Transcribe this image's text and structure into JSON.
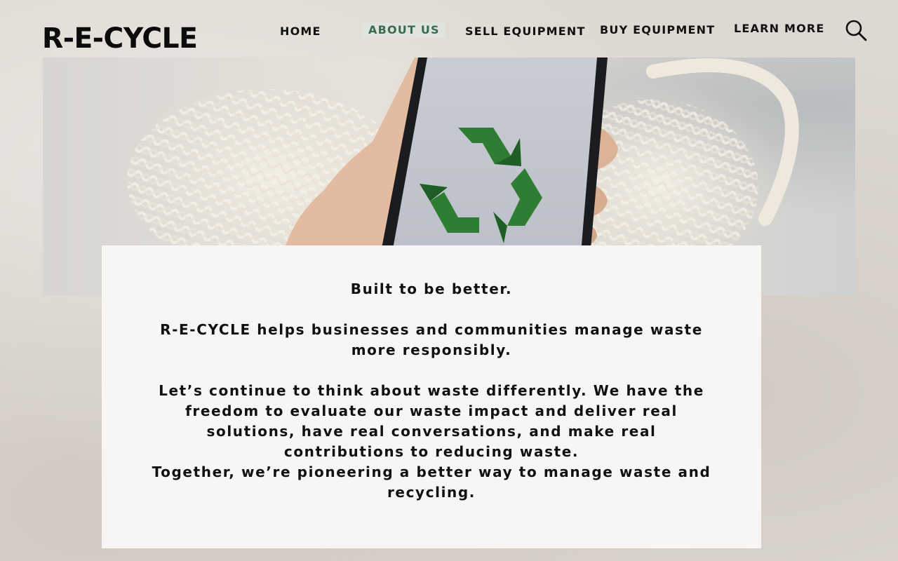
{
  "brand": {
    "logo": "R-E-CYCLE"
  },
  "nav": {
    "items": [
      {
        "label": "HOME"
      },
      {
        "label": "ABOUT US",
        "active": true
      },
      {
        "label": "SELL EQUIPMENT"
      },
      {
        "label": "BUY EQUIPMENT"
      },
      {
        "label": "LEARN MORE"
      }
    ],
    "search_icon": "search-icon"
  },
  "hero": {
    "image": "hand-holding-phone-with-recycle-symbol",
    "icon": "recycle-icon"
  },
  "content": {
    "headline": "Built to be better.",
    "intro": "R-E-CYCLE helps businesses and communities manage waste more responsibly.",
    "body": "Let’s continue to think about waste differently. We have the freedom to evaluate our waste impact and deliver real solutions, have real conversations, and make real contributions to reducing waste.",
    "closing": "Together, we’re pioneering a better way to manage waste and recycling."
  },
  "colors": {
    "background": "#ddd8d1",
    "card": "#f7f6f4",
    "accent": "#3b6b4f",
    "recycle_green": "#2e7d32"
  }
}
